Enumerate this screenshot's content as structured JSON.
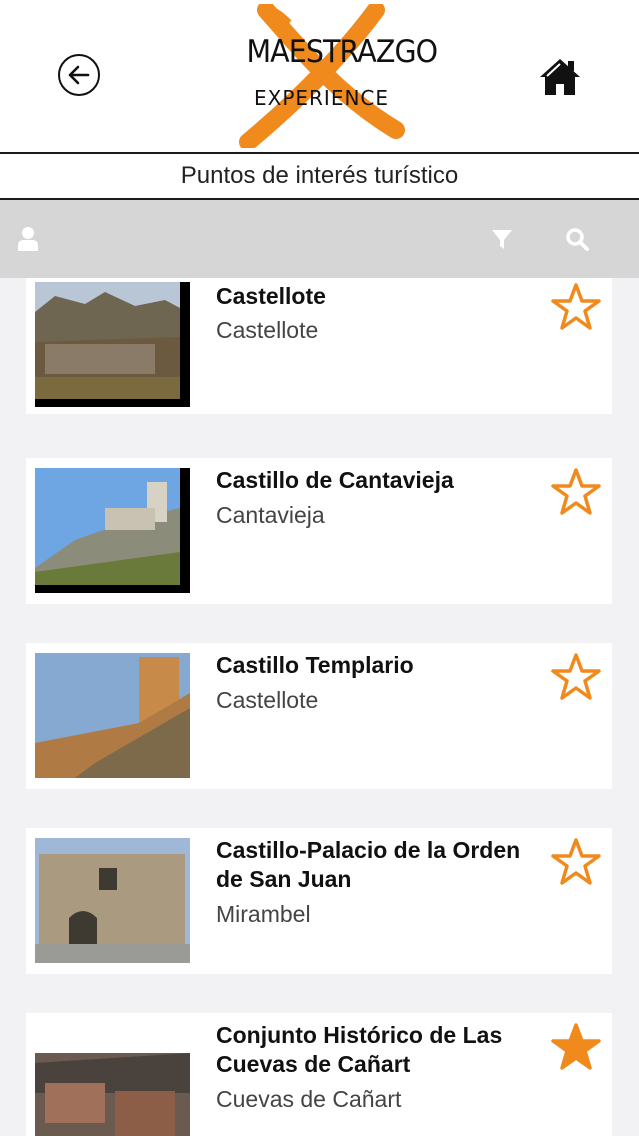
{
  "header": {
    "logo_line1": "MAESTRAZGO",
    "logo_line2": "EXPERIENCE",
    "back_icon": "arrow-left-circle-icon",
    "home_icon": "home-icon"
  },
  "page_title": "Puntos de interés turístico",
  "toolbar": {
    "user_icon": "user-icon",
    "filter_icon": "filter-icon",
    "search_icon": "search-icon"
  },
  "colors": {
    "accent": "#f08a1c",
    "toolbar_bg": "#d6d6d6",
    "list_bg": "#f2f2f4"
  },
  "items": [
    {
      "title": "Castellote",
      "subtitle": "Castellote",
      "favorite": false
    },
    {
      "title": "Castillo de Cantavieja",
      "subtitle": "Cantavieja",
      "favorite": false
    },
    {
      "title": "Castillo Templario",
      "subtitle": "Castellote",
      "favorite": false
    },
    {
      "title": "Castillo-Palacio de la Orden de San Juan",
      "subtitle": "Mirambel",
      "favorite": false
    },
    {
      "title": "Conjunto Histórico de Las Cuevas de Cañart",
      "subtitle": "Cuevas de Cañart",
      "favorite": true
    }
  ]
}
